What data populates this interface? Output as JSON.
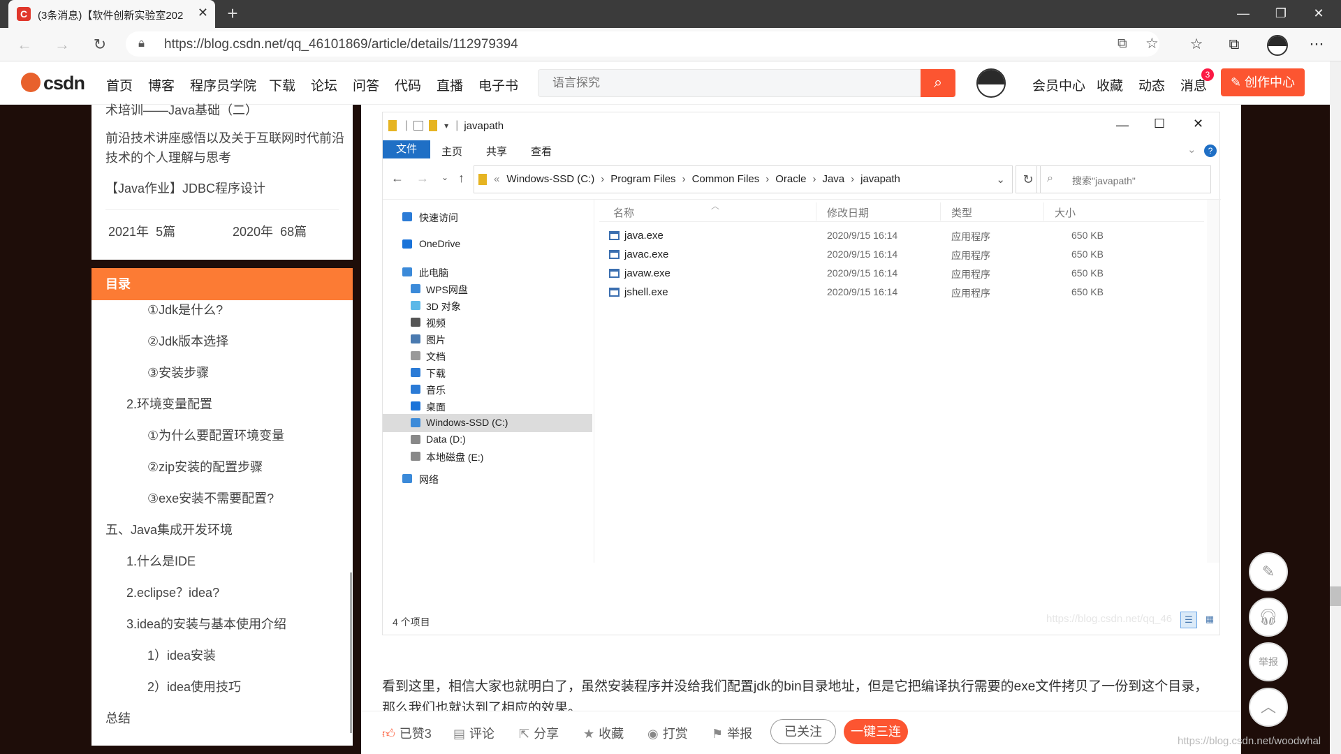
{
  "browser": {
    "tab_title": "(3条消息)【软件创新实验室202",
    "favicon": "C",
    "url": "https://blog.csdn.net/qq_46101869/article/details/112979394"
  },
  "csdn": {
    "logo": "csdn",
    "nav": [
      "首页",
      "博客",
      "程序员学院",
      "下载",
      "论坛",
      "问答",
      "代码",
      "直播",
      "电子书"
    ],
    "search_placeholder": "语言探究",
    "right_links": [
      "会员中心",
      "收藏",
      "动态",
      "消息"
    ],
    "badge": "3",
    "create": "创作中心"
  },
  "sidebar": {
    "related": [
      "术培训——Java基础（二）",
      "前沿技术讲座感悟以及关于互联网时代前沿技术的个人理解与思考",
      "【Java作业】JDBC程序设计"
    ],
    "archive": [
      {
        "year": "2021年",
        "count": "5篇"
      },
      {
        "year": "2020年",
        "count": "68篇"
      }
    ],
    "toc_title": "目录",
    "toc": [
      {
        "t": "①Jdk是什么?",
        "lvl": 3
      },
      {
        "t": "②Jdk版本选择",
        "lvl": 3
      },
      {
        "t": "③安装步骤",
        "lvl": 3
      },
      {
        "t": "2.环境变量配置",
        "lvl": 2
      },
      {
        "t": "①为什么要配置环境变量",
        "lvl": 3
      },
      {
        "t": "②zip安装的配置步骤",
        "lvl": 3
      },
      {
        "t": "③exe安装不需要配置?",
        "lvl": 3
      },
      {
        "t": "五、Java集成开发环境",
        "lvl": 1
      },
      {
        "t": "1.什么是IDE",
        "lvl": 2
      },
      {
        "t": "2.eclipse？idea?",
        "lvl": 2
      },
      {
        "t": "3.idea的安装与基本使用介绍",
        "lvl": 2
      },
      {
        "t": "1）idea安装",
        "lvl": 3
      },
      {
        "t": "2）idea使用技巧",
        "lvl": 3
      },
      {
        "t": "总结",
        "lvl": 1
      }
    ]
  },
  "explorer": {
    "title": "javapath",
    "ribbon": [
      "文件",
      "主页",
      "共享",
      "查看"
    ],
    "breadcrumb": [
      "Windows-SSD (C:)",
      "Program Files",
      "Common Files",
      "Oracle",
      "Java",
      "javapath"
    ],
    "search_placeholder": "搜索\"javapath\"",
    "nav": [
      {
        "label": "快速访问",
        "indent": 0,
        "icon": "star-icon",
        "color": "#2b7bd6"
      },
      {
        "label": "OneDrive",
        "indent": 0,
        "icon": "cloud-icon",
        "color": "#1a73d9"
      },
      {
        "label": "此电脑",
        "indent": 0,
        "icon": "computer-icon",
        "color": "#3b8ad9"
      },
      {
        "label": "WPS网盘",
        "indent": 1,
        "icon": "cloud-icon",
        "color": "#3b8ad9"
      },
      {
        "label": "3D 对象",
        "indent": 1,
        "icon": "cube-icon",
        "color": "#5bb8e8"
      },
      {
        "label": "视频",
        "indent": 1,
        "icon": "video-icon",
        "color": "#555"
      },
      {
        "label": "图片",
        "indent": 1,
        "icon": "picture-icon",
        "color": "#4a7ab0"
      },
      {
        "label": "文档",
        "indent": 1,
        "icon": "document-icon",
        "color": "#999"
      },
      {
        "label": "下载",
        "indent": 1,
        "icon": "download-icon",
        "color": "#2b7bd6"
      },
      {
        "label": "音乐",
        "indent": 1,
        "icon": "music-icon",
        "color": "#2b7bd6"
      },
      {
        "label": "桌面",
        "indent": 1,
        "icon": "desktop-icon",
        "color": "#1a73d9"
      },
      {
        "label": "Windows-SSD (C:)",
        "indent": 1,
        "icon": "drive-icon",
        "color": "#3b8ad9"
      },
      {
        "label": "Data (D:)",
        "indent": 1,
        "icon": "drive-icon",
        "color": "#888"
      },
      {
        "label": "本地磁盘 (E:)",
        "indent": 1,
        "icon": "drive-icon",
        "color": "#888"
      },
      {
        "label": "网络",
        "indent": 0,
        "icon": "network-icon",
        "color": "#3b8ad9"
      }
    ],
    "selected_nav": "Windows-SSD (C:)",
    "columns": [
      "名称",
      "修改日期",
      "类型",
      "大小"
    ],
    "files": [
      {
        "name": "java.exe",
        "date": "2020/9/15 16:14",
        "type": "应用程序",
        "size": "650 KB"
      },
      {
        "name": "javac.exe",
        "date": "2020/9/15 16:14",
        "type": "应用程序",
        "size": "650 KB"
      },
      {
        "name": "javaw.exe",
        "date": "2020/9/15 16:14",
        "type": "应用程序",
        "size": "650 KB"
      },
      {
        "name": "jshell.exe",
        "date": "2020/9/15 16:14",
        "type": "应用程序",
        "size": "650 KB"
      }
    ],
    "status": "4 个项目",
    "watermark": "https://blog.csdn.net/qq_46"
  },
  "article": {
    "paragraph": "看到这里，相信大家也就明白了，虽然安装程序并没给我们配置jdk的bin目录地址，但是它把编译执行需要的exe文件拷贝了一份到这个目录，那么我们也就达到了相应的效果。"
  },
  "actions": {
    "like": "已赞3",
    "comment": "评论",
    "share": "分享",
    "favorite": "收藏",
    "reward": "打赏",
    "report": "举报",
    "follow": "已关注",
    "triple": "一键三连"
  },
  "float": {
    "report": "举报"
  },
  "watermark2": "https://blog.csdn.net/woodwhal"
}
